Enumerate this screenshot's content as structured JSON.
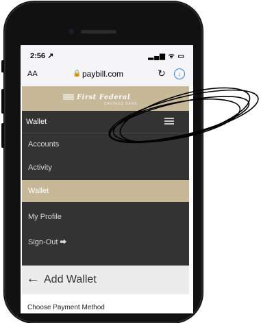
{
  "status_bar": {
    "time": "2:56 ↗",
    "icons": "▂▄▆ ᯤ ▭"
  },
  "browser": {
    "text_size": "AA",
    "url": "paybill.com",
    "lock_icon": "🔒",
    "reload_icon": "↻",
    "download_icon": "↓"
  },
  "brand": {
    "logo": "First Federal",
    "logo_sub": "SAVINGS BANK"
  },
  "nav": {
    "header_label": "Wallet",
    "items": [
      {
        "label": "Accounts"
      },
      {
        "label": "Activity"
      },
      {
        "label": "Wallet"
      },
      {
        "label": "My Profile"
      },
      {
        "label": "Sign-Out"
      }
    ],
    "signout_icon": "⮕"
  },
  "page": {
    "back_arrow": "←",
    "title": "Add Wallet",
    "section_label": "Choose Payment Method"
  },
  "colors": {
    "accent_tan": "#c7b898",
    "nav_bg": "#333333",
    "link_blue": "#1e7cf2"
  }
}
